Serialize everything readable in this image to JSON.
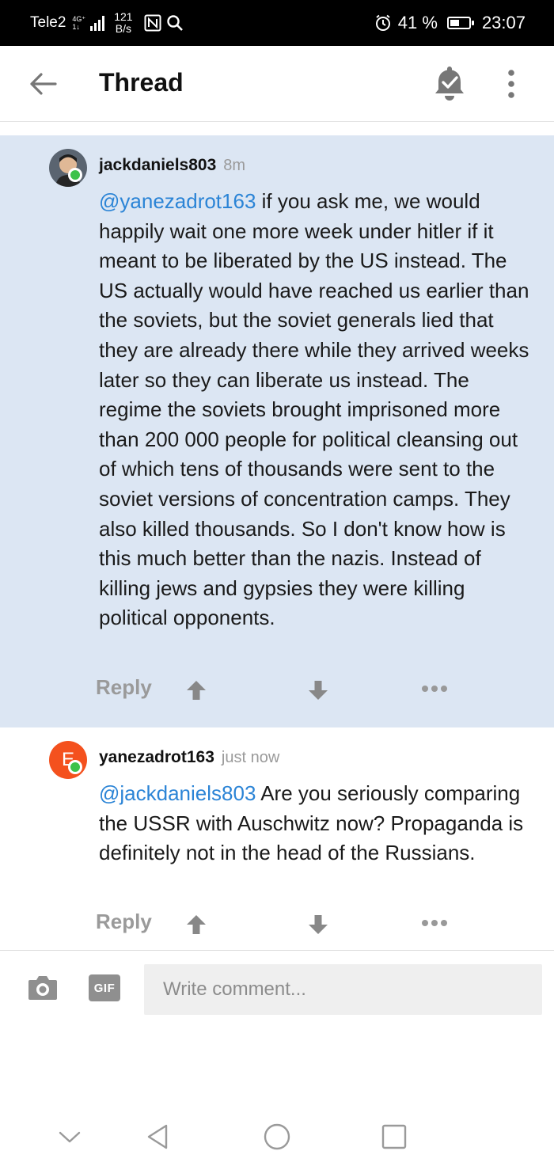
{
  "status_bar": {
    "carrier": "Tele2",
    "network_top": "4G⁺",
    "network_bottom": "1↓",
    "speed_value": "121",
    "speed_unit": "B/s",
    "alarm_icon": "alarm-icon",
    "battery_percent": "41 %",
    "battery_level": 0.41,
    "time": "23:07"
  },
  "app_bar": {
    "title": "Thread"
  },
  "comments": [
    {
      "author": "jackdaniels803",
      "time": "8m",
      "mention": "@yanezadrot163",
      "text": " if you ask me, we would happily wait one more week under hitler if it meant to be liberated by the US instead. The US actually would have reached us earlier than the soviets, but the soviet generals lied that they are already there while they arrived weeks later so they can liberate us instead. The regime the soviets brought imprisoned more than 200 000 people for political cleansing out of which tens of thousands were sent to the soviet versions of concentration camps. They also killed thousands. So I don't know how is this much better than the nazis. Instead of killing jews and gypsies they were killing political opponents.",
      "reply_label": "Reply"
    },
    {
      "author": "yanezadrot163",
      "time": "just now",
      "avatar_letter": "E",
      "avatar_color": "#f4511e",
      "mention": "@jackdaniels803",
      "text": " Are you seriously comparing the USSR with Auschwitz now? Propaganda is definitely not in the head of the Russians.",
      "reply_label": "Reply"
    }
  ],
  "comment_bar": {
    "gif_label": "GIF",
    "input_placeholder": "Write comment..."
  },
  "colors": {
    "highlight_bg": "#dce6f3",
    "mention": "#2b84d6",
    "online": "#3cc24a",
    "muted": "#9a9a9a"
  }
}
